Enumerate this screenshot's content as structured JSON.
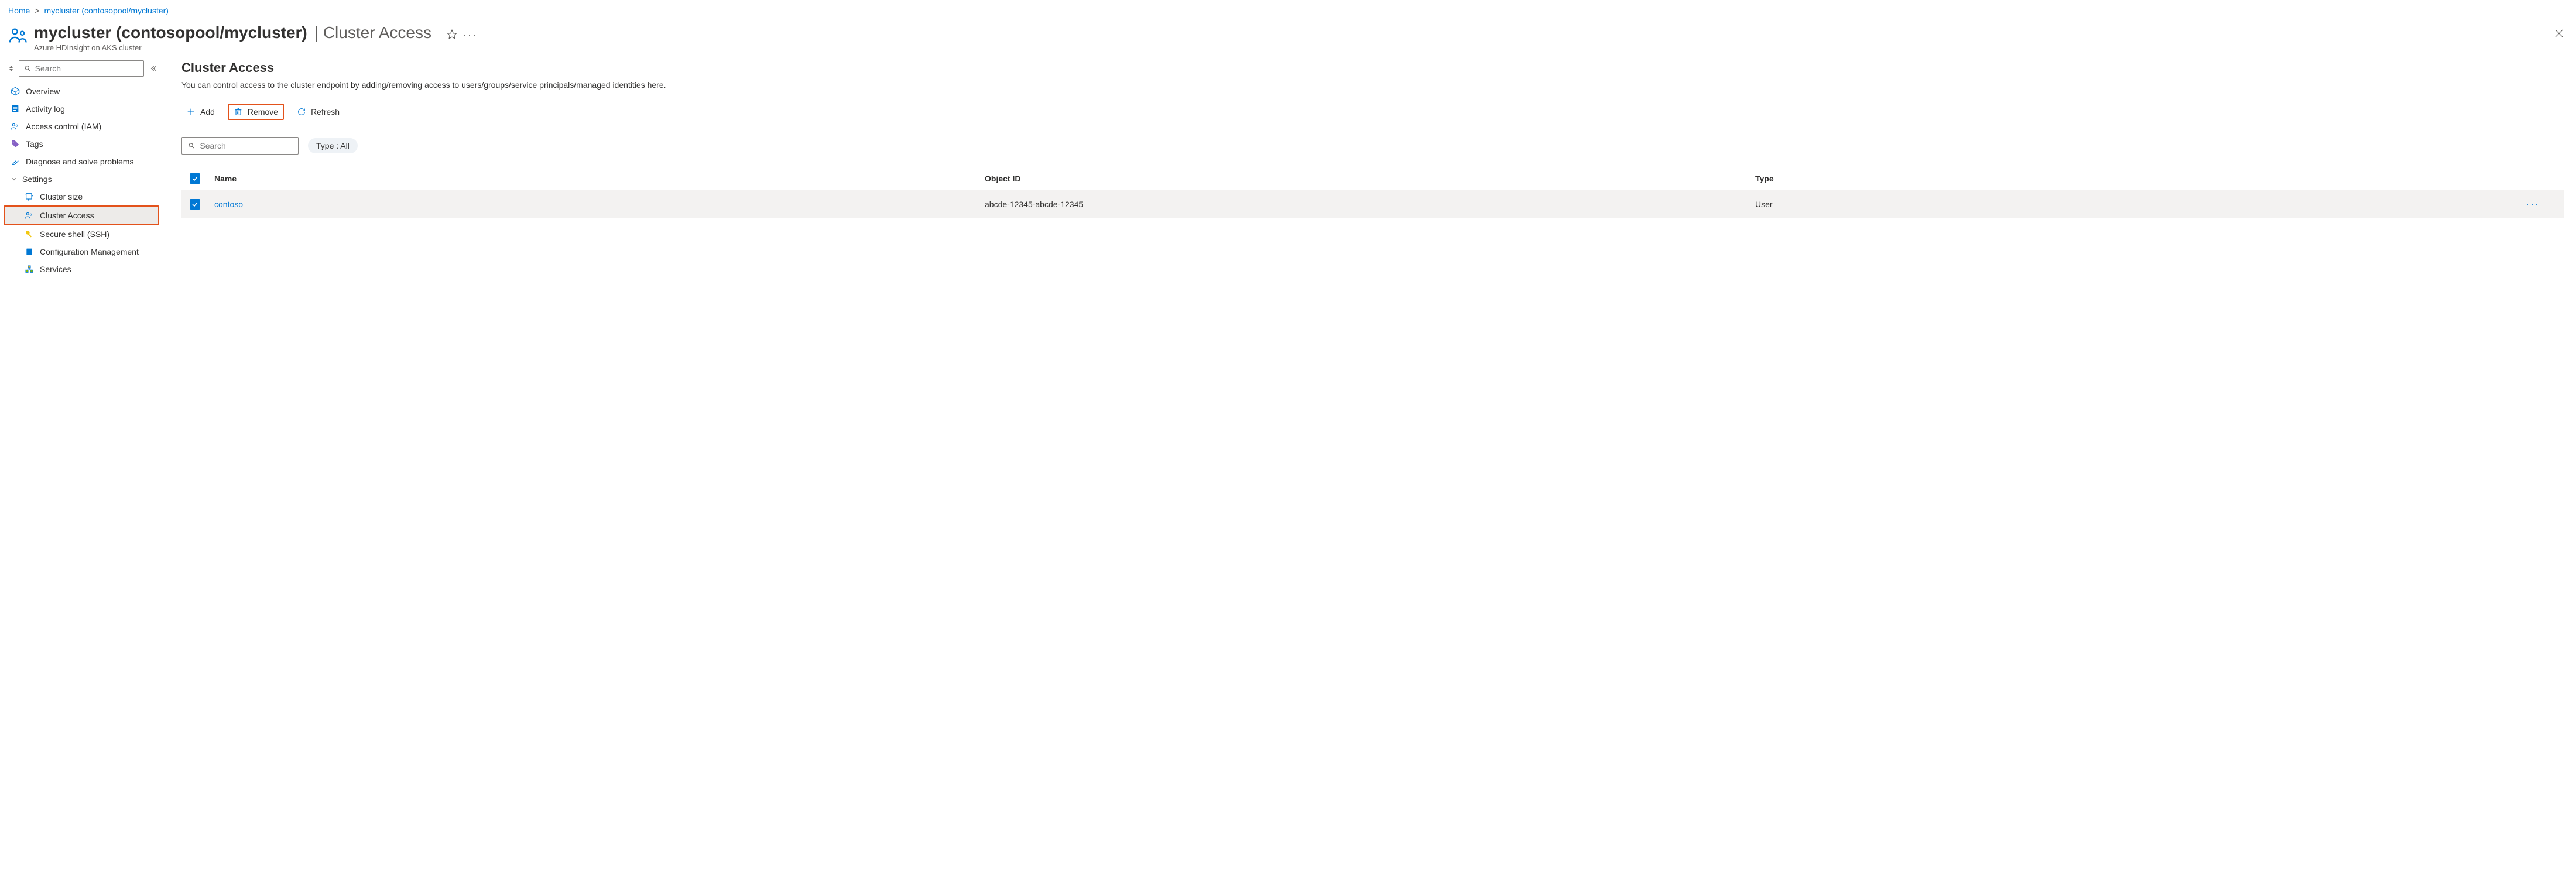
{
  "breadcrumb": {
    "home": "Home",
    "cluster": "mycluster (contosopool/mycluster)"
  },
  "header": {
    "title": "mycluster (contosopool/mycluster)",
    "section": "Cluster Access",
    "subtitle": "Azure HDInsight on AKS cluster"
  },
  "sidebar": {
    "search_placeholder": "Search",
    "items": {
      "overview": "Overview",
      "activity": "Activity log",
      "iam": "Access control (IAM)",
      "tags": "Tags",
      "diagnose": "Diagnose and solve problems",
      "settings": "Settings",
      "cluster_size": "Cluster size",
      "cluster_access": "Cluster Access",
      "ssh": "Secure shell (SSH)",
      "config": "Configuration Management",
      "services": "Services"
    }
  },
  "main": {
    "title": "Cluster Access",
    "description": "You can control access to the cluster endpoint by adding/removing access to users/groups/service principals/managed identities here.",
    "toolbar": {
      "add": "Add",
      "remove": "Remove",
      "refresh": "Refresh"
    },
    "filter": {
      "search_placeholder": "Search",
      "type_label": "Type :",
      "type_value": "All"
    },
    "table": {
      "headers": {
        "name": "Name",
        "object_id": "Object ID",
        "type": "Type"
      },
      "rows": [
        {
          "name": "contoso",
          "object_id": "abcde-12345-abcde-12345",
          "type": "User"
        }
      ]
    }
  }
}
